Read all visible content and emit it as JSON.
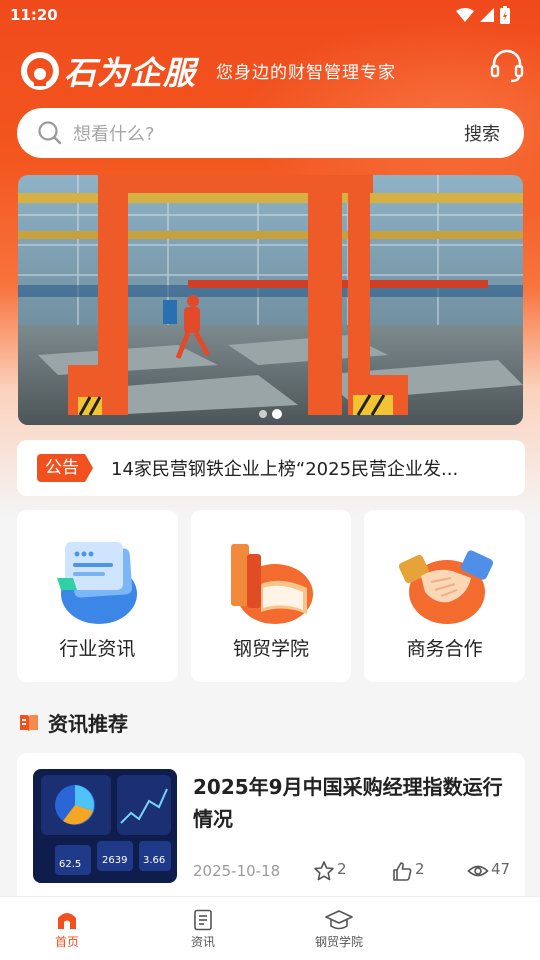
{
  "status_bar": {
    "time": "11:20"
  },
  "header": {
    "brand": "石为企服",
    "tagline": "您身边的财智管理专家",
    "service_icon": "headset-icon"
  },
  "search": {
    "placeholder": "想看什么?",
    "button_label": "搜索"
  },
  "banner": {
    "slide_count": 2,
    "active_slide": 2
  },
  "notice": {
    "tag": "公告",
    "text": "14家民营钢铁企业上榜“2025民营企业发..."
  },
  "quick_links": [
    {
      "label": "行业资讯",
      "icon": "news-document-icon"
    },
    {
      "label": "钢贸学院",
      "icon": "books-icon"
    },
    {
      "label": "商务合作",
      "icon": "handshake-icon"
    }
  ],
  "recommend": {
    "title": "资讯推荐",
    "articles": [
      {
        "title": "2025年9月中国采购经理指数运行情况",
        "date": "2025-10-18",
        "favorites": "2",
        "likes": "2",
        "views": "47",
        "thumb_figures": [
          "62.5",
          "2639",
          "3.66"
        ]
      }
    ]
  },
  "tabbar": [
    {
      "label": "首页",
      "icon": "home-icon",
      "active": true
    },
    {
      "label": "资讯",
      "icon": "document-icon",
      "active": false
    },
    {
      "label": "钢贸学院",
      "icon": "graduation-cap-icon",
      "active": false
    }
  ],
  "colors": {
    "brand": "#f0511e",
    "background": "#f5f5f6"
  }
}
